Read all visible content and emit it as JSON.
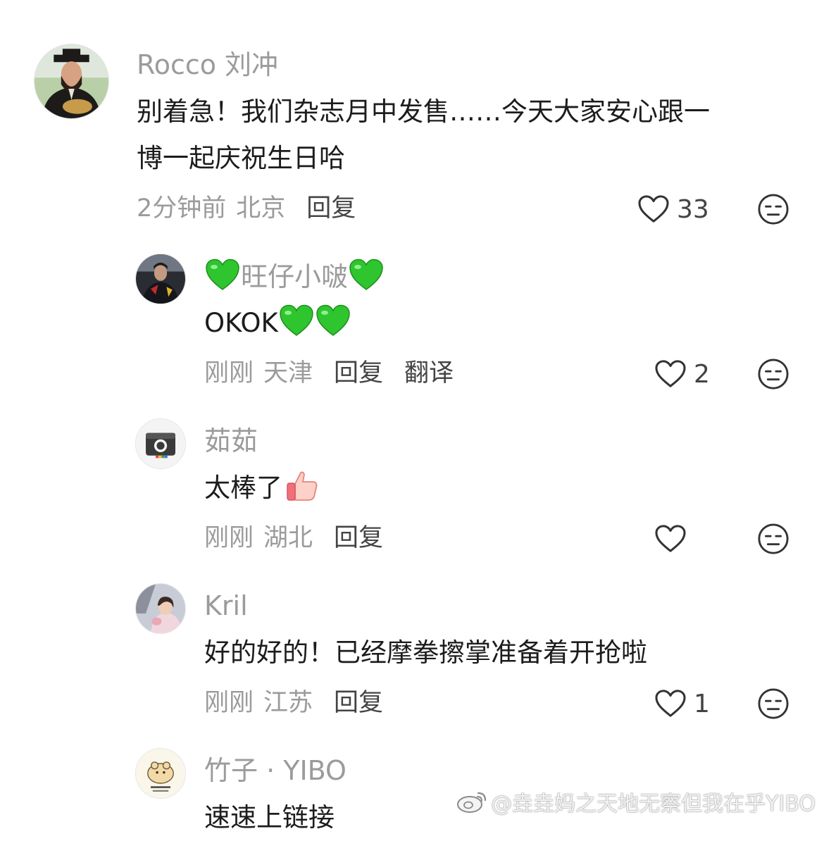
{
  "comments": [
    {
      "name": "Rocco 刘冲",
      "text_line1": "别着急！我们杂志月中发售……今天大家安心跟一",
      "text_line2": "博一起庆祝生日哈",
      "time": "2分钟前",
      "location": "北京",
      "reply": "回复",
      "likes": "33"
    },
    {
      "name": "旺仔小啵",
      "text": "OKOK",
      "time": "刚刚",
      "location": "天津",
      "reply": "回复",
      "translate": "翻译",
      "likes": "2"
    },
    {
      "name": "茹茹",
      "text": "太棒了",
      "time": "刚刚",
      "location": "湖北",
      "reply": "回复",
      "likes": ""
    },
    {
      "name": "Kril",
      "text": "好的好的！已经摩拳擦掌准备着开抢啦",
      "time": "刚刚",
      "location": "江苏",
      "reply": "回复",
      "likes": "1"
    },
    {
      "name": "竹子 · YIBO",
      "text": "速速上链接"
    }
  ],
  "icons": {
    "like": "heart-outline-icon",
    "dislike": "neutral-face-icon",
    "green_heart": "green-heart-emoji",
    "thumbs_up": "thumbs-up-emoji"
  },
  "colors": {
    "name": "#9b9b9b",
    "text": "#1c1c1c",
    "green_heart": "#2fc52f"
  },
  "watermark": {
    "text": "@垚垚妈之天地无察但我在乎YIBO"
  }
}
